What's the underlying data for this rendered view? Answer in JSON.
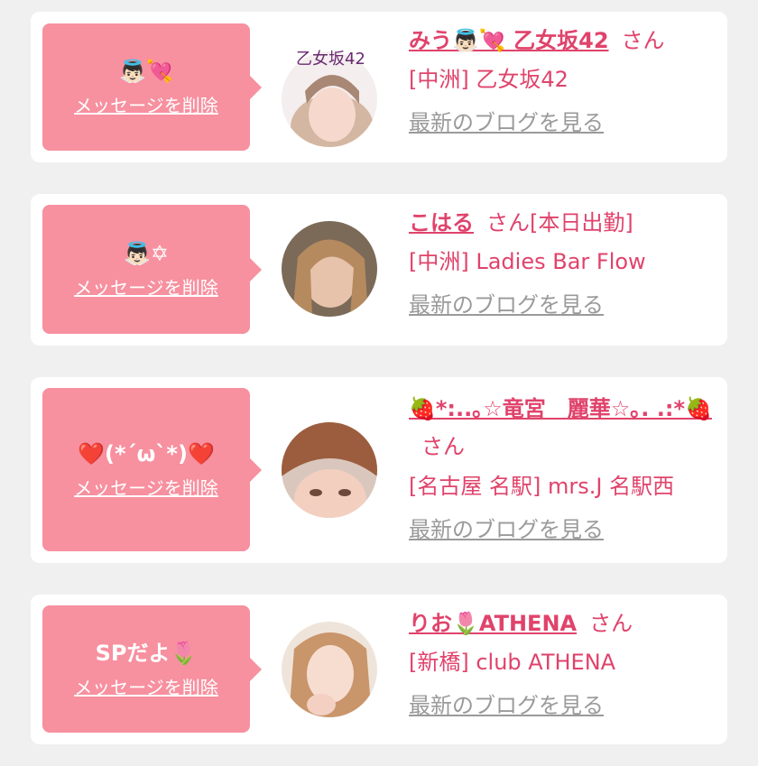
{
  "actions": {
    "delete_label": "メッセージを削除",
    "blog_label": "最新のブログを見る"
  },
  "honorific": "さん",
  "entries": [
    {
      "message": "👼🏻💘",
      "name": "みう👼🏻💘 乙女坂42",
      "status": "",
      "shop": "[中洲] 乙女坂42",
      "avatar_text": "乙女坂42"
    },
    {
      "message": "👼🏻✡",
      "name": "こはる",
      "status": "[本日出勤]",
      "shop": "[中洲] Ladies Bar Flow",
      "avatar_text": ""
    },
    {
      "message": "❤️(*´ω`*)❤️",
      "name": "🍓*:..｡☆竜宮　麗華☆｡. .:*🍓",
      "status": "",
      "shop": "[名古屋 名駅] mrs.J 名駅西",
      "avatar_text": ""
    },
    {
      "message": "SPだよ🌷",
      "name": "りお🌷ATHENA",
      "status": "",
      "shop": "[新橋] club ATHENA",
      "avatar_text": ""
    }
  ]
}
